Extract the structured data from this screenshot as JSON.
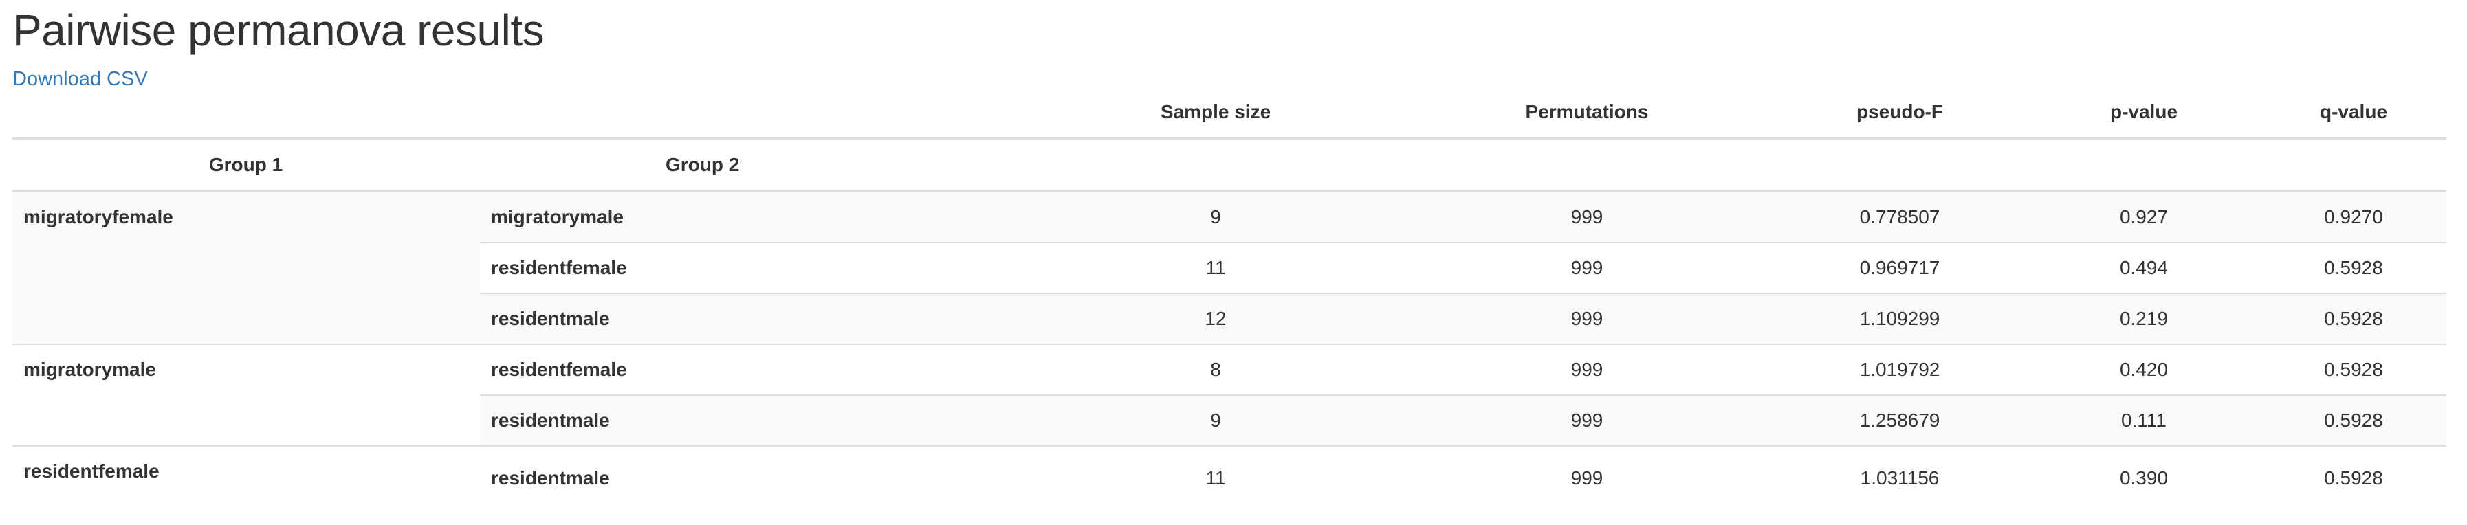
{
  "page": {
    "title": "Pairwise permanova results",
    "download_label": "Download CSV"
  },
  "table": {
    "headers_top": [
      "Sample size",
      "Permutations",
      "pseudo-F",
      "p-value",
      "q-value"
    ],
    "headers_group": [
      "Group 1",
      "Group 2"
    ],
    "groups": [
      {
        "group1": "migratoryfemale",
        "rows": [
          {
            "group2": "migratorymale",
            "sample_size": "9",
            "permutations": "999",
            "pseudo_f": "0.778507",
            "p_value": "0.927",
            "q_value": "0.9270"
          },
          {
            "group2": "residentfemale",
            "sample_size": "11",
            "permutations": "999",
            "pseudo_f": "0.969717",
            "p_value": "0.494",
            "q_value": "0.5928"
          },
          {
            "group2": "residentmale",
            "sample_size": "12",
            "permutations": "999",
            "pseudo_f": "1.109299",
            "p_value": "0.219",
            "q_value": "0.5928"
          }
        ]
      },
      {
        "group1": "migratorymale",
        "rows": [
          {
            "group2": "residentfemale",
            "sample_size": "8",
            "permutations": "999",
            "pseudo_f": "1.019792",
            "p_value": "0.420",
            "q_value": "0.5928"
          },
          {
            "group2": "residentmale",
            "sample_size": "9",
            "permutations": "999",
            "pseudo_f": "1.258679",
            "p_value": "0.111",
            "q_value": "0.5928"
          }
        ]
      },
      {
        "group1": "residentfemale",
        "rows": [
          {
            "group2": "residentmale",
            "sample_size": "11",
            "permutations": "999",
            "pseudo_f": "1.031156",
            "p_value": "0.390",
            "q_value": "0.5928"
          }
        ]
      }
    ]
  }
}
